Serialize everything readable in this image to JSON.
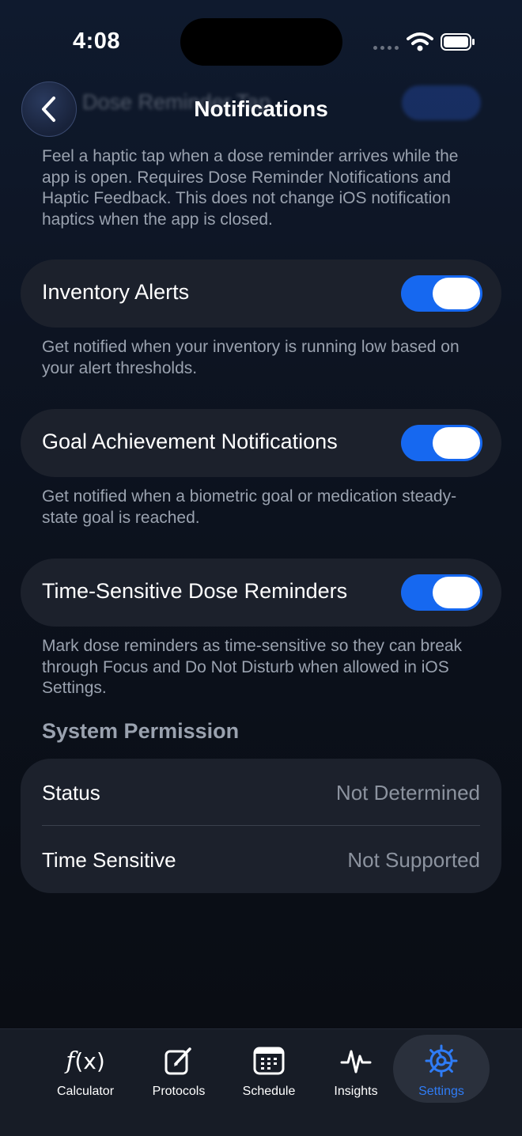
{
  "status_bar": {
    "time": "4:08"
  },
  "nav": {
    "title": "Notifications",
    "ghost_label": "Dose Reminder Tap"
  },
  "descriptions": {
    "dose_reminder_tap": "Feel a haptic tap when a dose reminder arrives while the app is open. Requires Dose Reminder Notifications and Haptic Feedback. This does not change iOS notification haptics when the app is closed.",
    "inventory_alerts": "Get notified when your inventory is running low based on your alert thresholds.",
    "goal_achievement": "Get notified when a biometric goal or medication steady-state goal is reached.",
    "time_sensitive": "Mark dose reminders as time-sensitive so they can break through Focus and Do Not Disturb when allowed in iOS Settings."
  },
  "settings": {
    "inventory_alerts": {
      "label": "Inventory Alerts",
      "enabled": true
    },
    "goal_achievement": {
      "label": "Goal Achievement Notifications",
      "enabled": true
    },
    "time_sensitive": {
      "label": "Time-Sensitive Dose Reminders",
      "enabled": true
    }
  },
  "system_permission": {
    "header": "System Permission",
    "rows": [
      {
        "key": "Status",
        "value": "Not Determined"
      },
      {
        "key": "Time Sensitive",
        "value": "Not Supported"
      }
    ]
  },
  "tabbar": {
    "selected": "Settings",
    "accent_color": "#2f7cf6",
    "tabs": [
      {
        "label": "Calculator",
        "icon": "function-icon"
      },
      {
        "label": "Protocols",
        "icon": "edit-square-icon"
      },
      {
        "label": "Schedule",
        "icon": "calendar-icon"
      },
      {
        "label": "Insights",
        "icon": "waveform-icon"
      },
      {
        "label": "Settings",
        "icon": "gear-icon"
      }
    ]
  },
  "colors": {
    "toggle_on": "#1668f0",
    "card": "#1c212c"
  }
}
